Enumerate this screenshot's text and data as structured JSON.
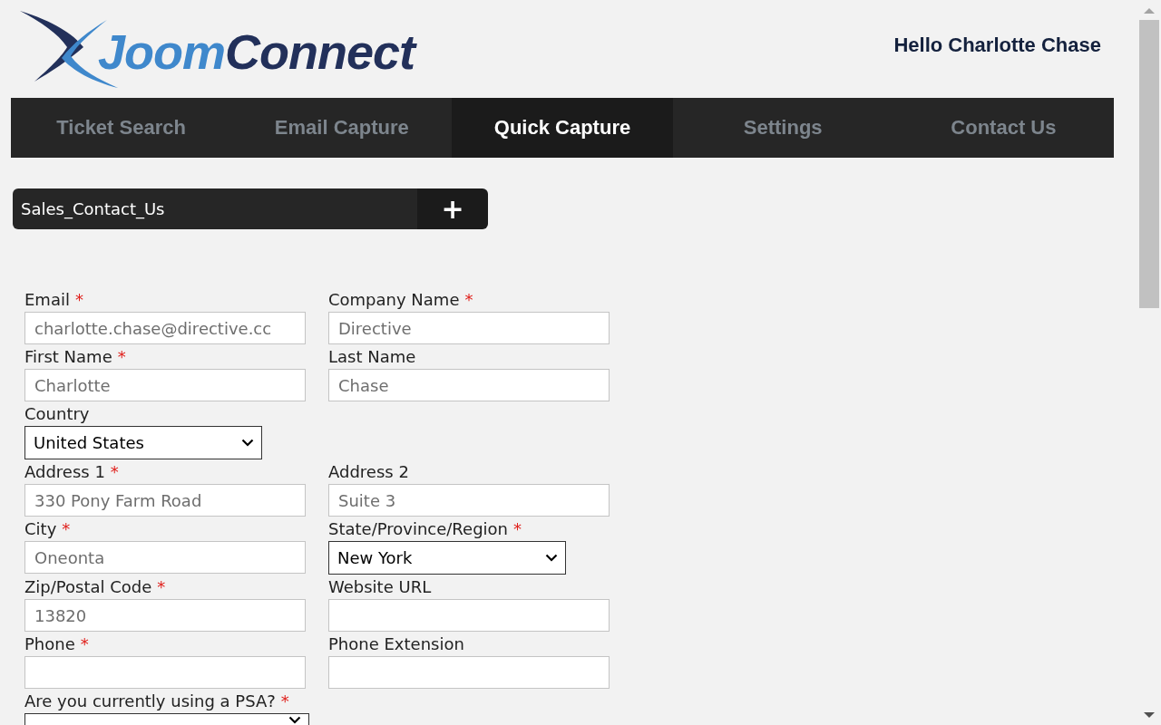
{
  "header": {
    "logo": {
      "part_1": "Joom",
      "part_2": "Connect"
    },
    "greeting": "Hello Charlotte Chase"
  },
  "tabs": [
    {
      "label": "Ticket Search",
      "selected": false
    },
    {
      "label": "Email Capture",
      "selected": false
    },
    {
      "label": "Quick Capture",
      "selected": true
    },
    {
      "label": "Settings",
      "selected": false
    },
    {
      "label": "Contact Us",
      "selected": false
    }
  ],
  "form_picker": {
    "value": "Sales_Contact_Us",
    "add_button": "+"
  },
  "required_marker": "*",
  "form_rows": [
    [
      {
        "label": "Email",
        "required": true,
        "kind": "input",
        "value": "charlotte.chase@directive.cc"
      },
      {
        "label": "Company Name",
        "required": true,
        "kind": "input",
        "value": "Directive"
      }
    ],
    [
      {
        "label": "First Name",
        "required": true,
        "kind": "input",
        "value": "Charlotte"
      },
      {
        "label": "Last Name",
        "required": false,
        "kind": "input",
        "value": "Chase"
      }
    ],
    [
      {
        "label": "Country",
        "required": false,
        "kind": "select",
        "value": "United States"
      }
    ],
    [
      {
        "label": "Address 1",
        "required": true,
        "kind": "input",
        "value": "330 Pony Farm Road"
      },
      {
        "label": "Address 2",
        "required": false,
        "kind": "input",
        "value": "Suite 3"
      }
    ],
    [
      {
        "label": "City",
        "required": true,
        "kind": "input",
        "value": "Oneonta"
      },
      {
        "label": "State/Province/Region",
        "required": true,
        "kind": "select",
        "value": "New York"
      }
    ],
    [
      {
        "label": "Zip/Postal Code",
        "required": true,
        "kind": "input",
        "value": "13820"
      },
      {
        "label": "Website URL",
        "required": false,
        "kind": "input"
      }
    ],
    [
      {
        "label": "Phone",
        "required": true,
        "kind": "input"
      },
      {
        "label": "Phone Extension",
        "required": false,
        "kind": "input"
      }
    ],
    [
      {
        "label": "Are you currently using a PSA?",
        "required": true,
        "kind": "select"
      }
    ]
  ]
}
